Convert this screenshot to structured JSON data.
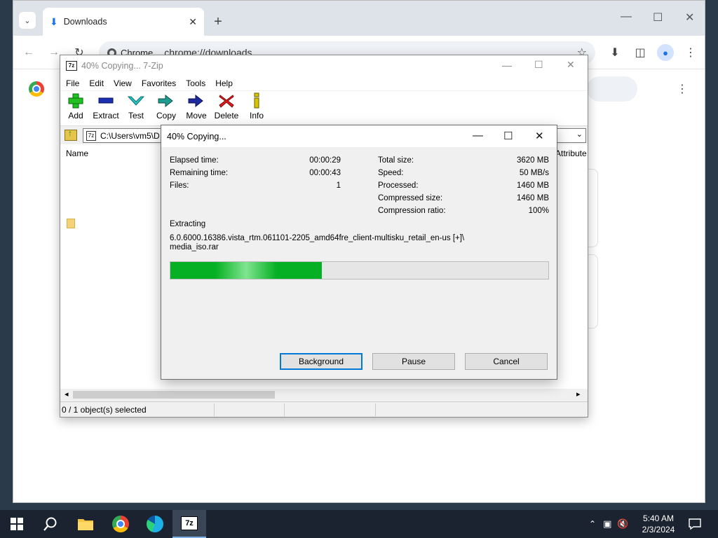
{
  "chrome": {
    "tab_title": "Downloads",
    "chip_label": "Chrome",
    "url": "chrome://downloads"
  },
  "zip": {
    "title": "40% Copying... 7-Zip",
    "logo_text": "7z",
    "menu": [
      "File",
      "Edit",
      "View",
      "Favorites",
      "Tools",
      "Help"
    ],
    "tools": [
      "Add",
      "Extract",
      "Test",
      "Copy",
      "Move",
      "Delete",
      "Info"
    ],
    "address": "C:\\Users\\vm5\\D",
    "col_name": "Name",
    "col_attributes": "Attribute",
    "status": "0 / 1 object(s) selected"
  },
  "dialog": {
    "title": "40% Copying...",
    "elapsed_label": "Elapsed time:",
    "elapsed_value": "00:00:29",
    "remaining_label": "Remaining time:",
    "remaining_value": "00:00:43",
    "files_label": "Files:",
    "files_value": "1",
    "total_label": "Total size:",
    "total_value": "3620 MB",
    "speed_label": "Speed:",
    "speed_value": "50 MB/s",
    "processed_label": "Processed:",
    "processed_value": "1460 MB",
    "compressed_label": "Compressed size:",
    "compressed_value": "1460 MB",
    "ratio_label": "Compression ratio:",
    "ratio_value": "100%",
    "action": "Extracting",
    "file_line1": "6.0.6000.16386.vista_rtm.061101-2205_amd64fre_client-multisku_retail_en-us [+]\\",
    "file_line2": "media_iso.rar",
    "progress": 0.4,
    "btn_background": "Background",
    "btn_pause": "Pause",
    "btn_cancel": "Cancel"
  },
  "taskbar": {
    "time": "5:40 AM",
    "date": "2/3/2024"
  },
  "colors": {
    "progress_green": "#06b025",
    "accent_blue": "#0078d7"
  }
}
